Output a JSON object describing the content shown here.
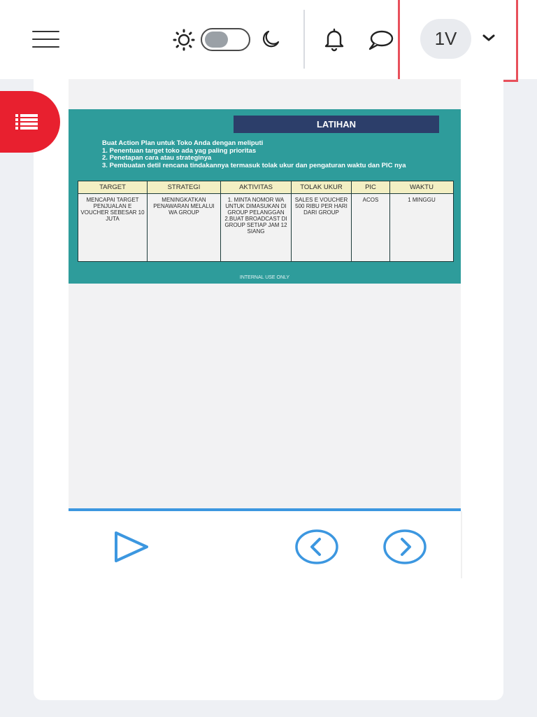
{
  "header": {
    "menu_icon": "hamburger-icon",
    "theme": {
      "sun_icon": "sun-icon",
      "moon_icon": "moon-icon",
      "dark_mode": false
    },
    "notifications_icon": "bell-icon",
    "messages_icon": "chat-bubble-icon",
    "user": {
      "initials": "1V",
      "dropdown_icon": "chevron-down-icon"
    }
  },
  "sidebar_tab": {
    "icon": "list-icon"
  },
  "slide": {
    "title": "LATIHAN",
    "intro_lines": [
      "Buat Action Plan untuk Toko Anda dengan meliputi",
      "1. Penentuan target toko ada yag paling prioritas",
      "2. Penetapan cara atau strateginya",
      "3. Pembuatan detil rencana tindakannya termasuk tolak ukur dan pengaturan waktu dan PIC nya"
    ],
    "table": {
      "headers": [
        "TARGET",
        "STRATEGI",
        "AKTIVITAS",
        "TOLAK UKUR",
        "PIC",
        "WAKTU"
      ],
      "row": [
        "MENCAPAI TARGET PENJUALAN E VOUCHER SEBESAR 10 JUTA",
        "MENINGKATKAN PENAWARAN MELALUI WA GROUP",
        "1. MINTA NOMOR WA UNTUK DIMASUKAN DI GROUP PELANGGAN 2.BUAT BROADCAST DI GROUP SETIAP JAM 12 SIANG",
        "SALES E VOUCHER 500 RIBU PER HARI DARI GROUP",
        "ACOS",
        "1 MINGGU"
      ]
    },
    "footer": "INTERNAL USE ONLY"
  },
  "player": {
    "progress_percent": 100,
    "play_icon": "play-icon",
    "prev_icon": "previous-icon",
    "next_icon": "next-icon"
  },
  "colors": {
    "accent_red": "#e8202f",
    "slide_teal": "#2e9c9b",
    "slide_title_navy": "#2c3e6a",
    "player_blue": "#3c97e0",
    "highlight_border": "#e8505b"
  }
}
